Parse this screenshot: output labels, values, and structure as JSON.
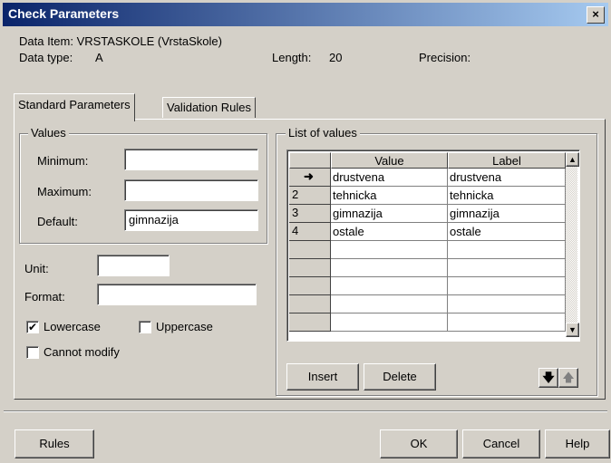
{
  "window": {
    "title": "Check Parameters",
    "close_glyph": "×"
  },
  "info": {
    "data_item": "Data Item:  VRSTASKOLE  (VrstaSkole)",
    "data_type_label": "Data type:",
    "data_type_value": "A",
    "length_label": "Length:",
    "length_value": "20",
    "precision_label": "Precision:"
  },
  "tabs": [
    {
      "label": "Standard Parameters",
      "active": true
    },
    {
      "label": "Validation Rules",
      "active": false
    }
  ],
  "values_group": {
    "title": "Values",
    "minimum_label": "Minimum:",
    "minimum_value": "",
    "maximum_label": "Maximum:",
    "maximum_value": "",
    "default_label": "Default:",
    "default_value": "gimnazija"
  },
  "unit": {
    "label": "Unit:",
    "value": ""
  },
  "format": {
    "label": "Format:",
    "value": ""
  },
  "checkboxes": {
    "lowercase": {
      "label": "Lowercase",
      "checked": true
    },
    "uppercase": {
      "label": "Uppercase",
      "checked": false
    },
    "cannot_modify": {
      "label": "Cannot modify",
      "checked": false
    }
  },
  "list_group": {
    "title": "List of values",
    "columns": [
      "Value",
      "Label"
    ],
    "rows": [
      {
        "row_header": "➜",
        "value": "drustvena",
        "label": "drustvena"
      },
      {
        "row_header": "2",
        "value": "tehnicka",
        "label": "tehnicka"
      },
      {
        "row_header": "3",
        "value": "gimnazija",
        "label": "gimnazija"
      },
      {
        "row_header": "4",
        "value": "ostale",
        "label": "ostale"
      },
      {
        "row_header": "",
        "value": "",
        "label": ""
      },
      {
        "row_header": "",
        "value": "",
        "label": ""
      },
      {
        "row_header": "",
        "value": "",
        "label": ""
      },
      {
        "row_header": "",
        "value": "",
        "label": ""
      },
      {
        "row_header": "",
        "value": "",
        "label": ""
      }
    ],
    "insert_label": "Insert",
    "delete_label": "Delete",
    "move_down_glyph": "🡇",
    "move_up_glyph": "🡅"
  },
  "bottom": {
    "rules_label": "Rules",
    "ok_label": "OK",
    "cancel_label": "Cancel",
    "help_label": "Help"
  }
}
